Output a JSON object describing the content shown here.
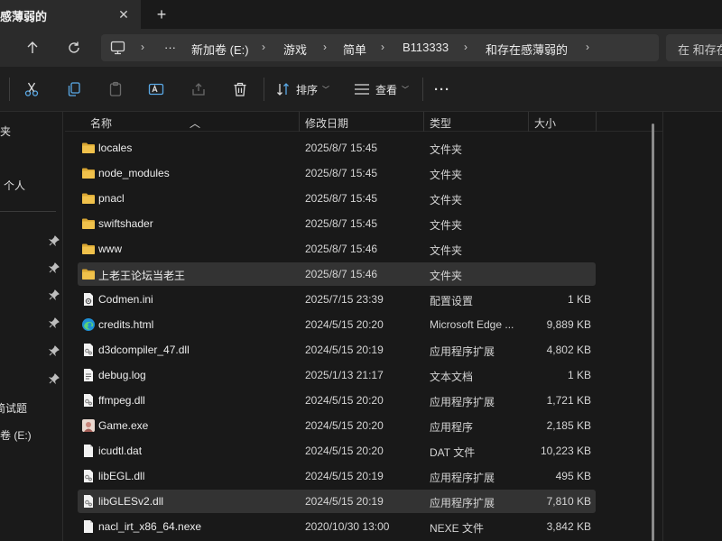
{
  "tab": {
    "title": "感薄弱的",
    "close": "✕",
    "new": "+"
  },
  "nav": {
    "breadcrumb": [
      "···",
      "新加卷 (E:)",
      "游戏",
      "简单",
      "B113333",
      "和存在感薄弱的"
    ],
    "search_placeholder": "在 和存在"
  },
  "toolbar": {
    "sort_label": "排序",
    "view_label": "查看",
    "more_label": "···"
  },
  "sidebar": {
    "labels": [
      "夹",
      "个人",
      "简试题",
      "卷 (E:)"
    ]
  },
  "columns": {
    "name": "名称",
    "date": "修改日期",
    "type": "类型",
    "size": "大小"
  },
  "files": [
    {
      "name": "locales",
      "date": "2025/8/7 15:45",
      "type": "文件夹",
      "size": "",
      "icon": "folder-icon"
    },
    {
      "name": "node_modules",
      "date": "2025/8/7 15:45",
      "type": "文件夹",
      "size": "",
      "icon": "folder-icon"
    },
    {
      "name": "pnacl",
      "date": "2025/8/7 15:45",
      "type": "文件夹",
      "size": "",
      "icon": "folder-icon"
    },
    {
      "name": "swiftshader",
      "date": "2025/8/7 15:45",
      "type": "文件夹",
      "size": "",
      "icon": "folder-icon"
    },
    {
      "name": "www",
      "date": "2025/8/7 15:46",
      "type": "文件夹",
      "size": "",
      "icon": "folder-icon"
    },
    {
      "name": "上老王论坛当老王",
      "date": "2025/8/7 15:46",
      "type": "文件夹",
      "size": "",
      "icon": "folder-icon",
      "selected": true
    },
    {
      "name": "Codmen.ini",
      "date": "2025/7/15 23:39",
      "type": "配置设置",
      "size": "1 KB",
      "icon": "settings-file-icon"
    },
    {
      "name": "credits.html",
      "date": "2024/5/15 20:20",
      "type": "Microsoft Edge ...",
      "size": "9,889 KB",
      "icon": "edge-icon"
    },
    {
      "name": "d3dcompiler_47.dll",
      "date": "2024/5/15 20:19",
      "type": "应用程序扩展",
      "size": "4,802 KB",
      "icon": "dll-icon"
    },
    {
      "name": "debug.log",
      "date": "2025/1/13 21:17",
      "type": "文本文档",
      "size": "1 KB",
      "icon": "text-file-icon"
    },
    {
      "name": "ffmpeg.dll",
      "date": "2024/5/15 20:20",
      "type": "应用程序扩展",
      "size": "1,721 KB",
      "icon": "dll-icon"
    },
    {
      "name": "Game.exe",
      "date": "2024/5/15 20:20",
      "type": "应用程序",
      "size": "2,185 KB",
      "icon": "game-exe-icon"
    },
    {
      "name": "icudtl.dat",
      "date": "2024/5/15 20:20",
      "type": "DAT 文件",
      "size": "10,223 KB",
      "icon": "blank-file-icon"
    },
    {
      "name": "libEGL.dll",
      "date": "2024/5/15 20:19",
      "type": "应用程序扩展",
      "size": "495 KB",
      "icon": "dll-icon"
    },
    {
      "name": "libGLESv2.dll",
      "date": "2024/5/15 20:19",
      "type": "应用程序扩展",
      "size": "7,810 KB",
      "icon": "dll-icon",
      "selected": true
    },
    {
      "name": "nacl_irt_x86_64.nexe",
      "date": "2020/10/30 13:00",
      "type": "NEXE 文件",
      "size": "3,842 KB",
      "icon": "blank-file-icon"
    }
  ],
  "colors": {
    "folder": "#e9b840",
    "selected_row": "#333333",
    "background": "#191919"
  }
}
